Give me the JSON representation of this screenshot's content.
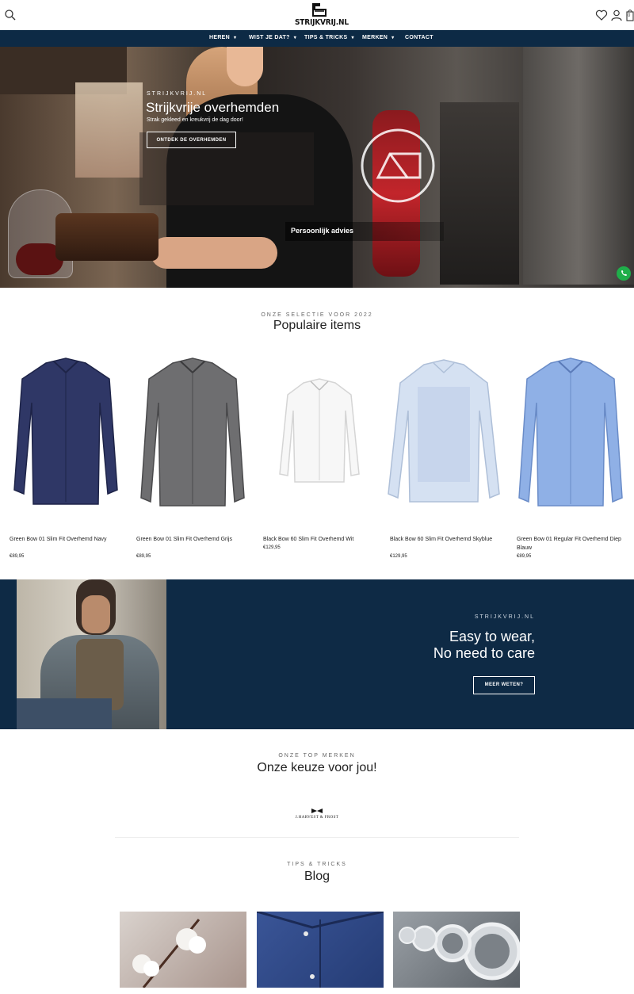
{
  "header": {
    "logo_text": "STRIJKVRIJ.NL",
    "icons": [
      "search-icon",
      "heart-icon",
      "user-icon",
      "cart-icon"
    ],
    "cart_count": "0"
  },
  "nav": {
    "items": [
      {
        "label": "HEREN",
        "dropdown": true
      },
      {
        "label": "WIST JE DAT?",
        "dropdown": true
      },
      {
        "label": "TIPS & TRICKS",
        "dropdown": true
      },
      {
        "label": "MERKEN",
        "dropdown": true
      },
      {
        "label": "CONTACT",
        "dropdown": false
      }
    ]
  },
  "hero": {
    "kicker": "STRIJKVRIJ.NL",
    "title": "Strijkvrije overhemden",
    "subtitle": "Strak gekleed en kreukvrij de dag door!",
    "button": "ONTDEK DE OVERHEMDEN",
    "advies": "Persoonlijk advies"
  },
  "popular": {
    "kicker": "ONZE SELECTIE VOOR 2022",
    "title": "Populaire items",
    "products": [
      {
        "name": "Green Bow 01 Slim Fit Overhemd Navy",
        "price": "€89,95",
        "color": "#2f3766"
      },
      {
        "name": "Green Bow 01 Slim Fit Overhemd Grijs",
        "price": "€89,95",
        "color": "#6e6e70"
      },
      {
        "name": "Black Bow 60 Slim Fit Overhemd Wit",
        "price": "€129,95",
        "color": "#f7f7f7"
      },
      {
        "name": "Black Bow 60 Slim Fit Overhemd Skyblue",
        "price": "€129,95",
        "color": "#d5e1f2"
      },
      {
        "name": "Green Bow 01 Regular Fit Overhemd Diep Blauw",
        "price": "€89,95",
        "color": "#8fb0e6"
      }
    ]
  },
  "banner": {
    "kicker": "STRIJKVRIJ.NL",
    "title_line1": "Easy to wear,",
    "title_line2": "No need to care",
    "button": "MEER WETEN?"
  },
  "brands": {
    "kicker": "ONZE TOP MERKEN",
    "title": "Onze keuze voor jou!",
    "logo_text": "J.HARVEST & FROST"
  },
  "blog": {
    "kicker": "TIPS & TRICKS",
    "title": "Blog"
  },
  "colors": {
    "navy": "#0d2a45",
    "whatsapp": "#1fae4a"
  }
}
